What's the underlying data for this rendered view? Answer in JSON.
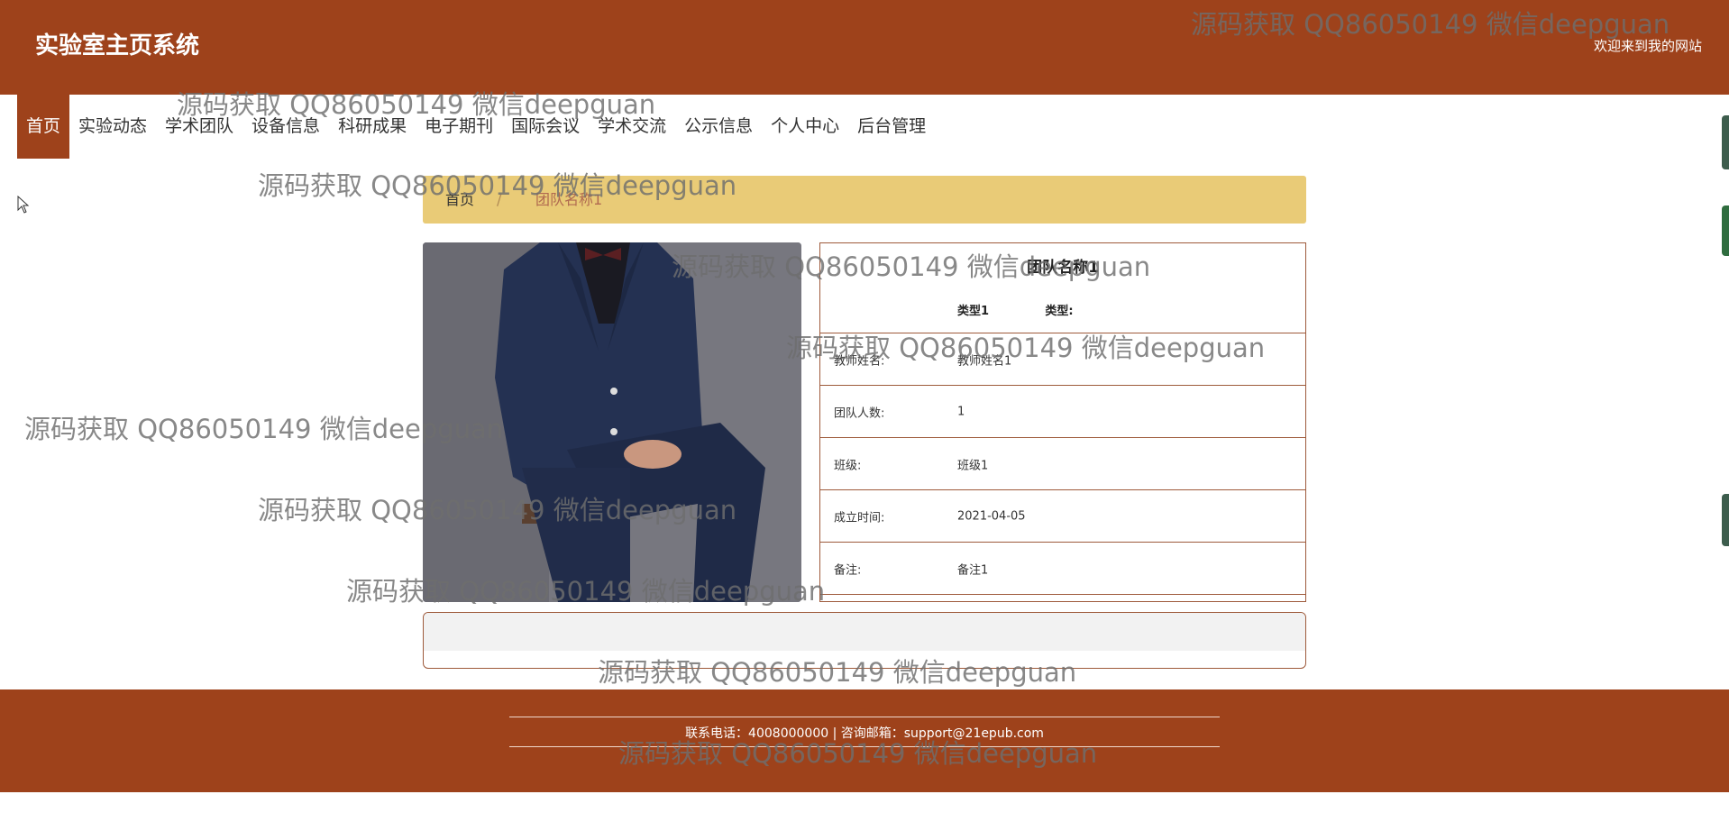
{
  "header": {
    "site_title": "实验室主页系统",
    "welcome": "欢迎来到我的网站"
  },
  "nav": {
    "items": [
      {
        "label": "首页",
        "active": true
      },
      {
        "label": "实验动态"
      },
      {
        "label": "学术团队"
      },
      {
        "label": "设备信息"
      },
      {
        "label": "科研成果"
      },
      {
        "label": "电子期刊"
      },
      {
        "label": "国际会议"
      },
      {
        "label": "学术交流"
      },
      {
        "label": "公示信息"
      },
      {
        "label": "个人中心"
      },
      {
        "label": "后台管理"
      }
    ]
  },
  "breadcrumb": {
    "home": "首页",
    "separator": "/",
    "current": "团队名称1"
  },
  "detail": {
    "title": "团队名称1",
    "type_label": "类型:",
    "type_value": "类型1",
    "rows": [
      {
        "label": "教师姓名:",
        "value": "教师姓名1"
      },
      {
        "label": "团队人数:",
        "value": "1"
      },
      {
        "label": "班级:",
        "value": "班级1"
      },
      {
        "label": "成立时间:",
        "value": "2021-04-05"
      },
      {
        "label": "备注:",
        "value": "备注1"
      }
    ]
  },
  "footer": {
    "contact": "联系电话：4008000000 | 咨询邮箱：support@21epub.com"
  },
  "watermark": "源码获取 QQ86050149 微信deepguan",
  "colors": {
    "brand": "#9e421b",
    "breadcrumb_bg": "#e9cb77",
    "border": "#9e5a3b"
  }
}
